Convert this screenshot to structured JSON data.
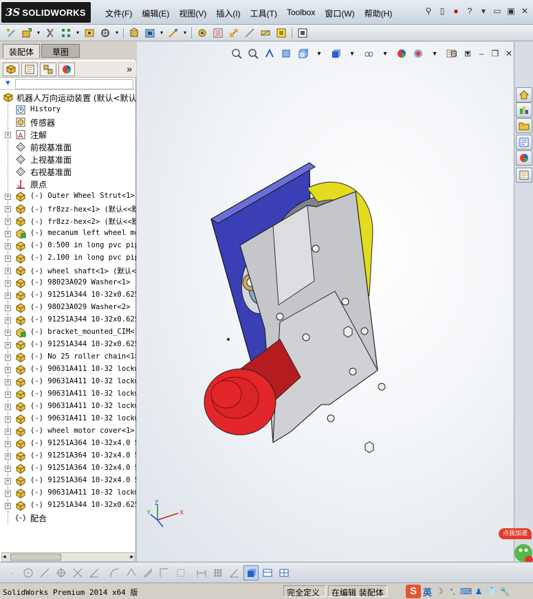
{
  "app": {
    "logo_prefix": "3S",
    "logo_text": "SOLIDWORKS"
  },
  "menu": [
    "文件(F)",
    "编辑(E)",
    "视图(V)",
    "插入(I)",
    "工具(T)",
    "Toolbox",
    "窗口(W)",
    "帮助(H)"
  ],
  "panel": {
    "tabs": [
      "装配体",
      "草图"
    ],
    "filter_placeholder": ""
  },
  "tree": {
    "root": "机器人万向运动装置  (默认<默认",
    "items": [
      {
        "label": "History",
        "icon": "history-icon",
        "expandable": false,
        "mono": true
      },
      {
        "label": "传感器",
        "icon": "sensor-icon",
        "expandable": false,
        "mono": false
      },
      {
        "label": "注解",
        "icon": "annotation-icon",
        "expandable": true,
        "mono": false
      },
      {
        "label": "前视基准面",
        "icon": "plane-icon",
        "expandable": false,
        "mono": false
      },
      {
        "label": "上视基准面",
        "icon": "plane-icon",
        "expandable": false,
        "mono": false
      },
      {
        "label": "右视基准面",
        "icon": "plane-icon",
        "expandable": false,
        "mono": false
      },
      {
        "label": "原点",
        "icon": "origin-icon",
        "expandable": false,
        "mono": false
      },
      {
        "label": "(-) Outer Wheel Strut<1>",
        "icon": "part-icon",
        "expandable": true,
        "mono": true
      },
      {
        "label": "(-) fr8zz-hex<1> (默认<<默",
        "icon": "part-icon",
        "expandable": true,
        "mono": true
      },
      {
        "label": "(-) fr8zz-hex<2> (默认<<默",
        "icon": "part-icon",
        "expandable": true,
        "mono": true
      },
      {
        "label": "(-) mecanum left wheel mod",
        "icon": "subassembly-icon",
        "expandable": true,
        "mono": true
      },
      {
        "label": "(-) 0.500 in long pvc pipe",
        "icon": "part-icon",
        "expandable": true,
        "mono": true
      },
      {
        "label": "(-) 2.100 in long pvc pipe",
        "icon": "part-icon",
        "expandable": true,
        "mono": true
      },
      {
        "label": "(-) wheel shaft<1> (默认<",
        "icon": "part-icon",
        "expandable": true,
        "mono": true
      },
      {
        "label": "(-) 98023A029 Washer<1> (",
        "icon": "part-icon",
        "expandable": true,
        "mono": true
      },
      {
        "label": "(-) 91251A344 10-32x0.625",
        "icon": "part-icon",
        "expandable": true,
        "mono": true
      },
      {
        "label": "(-) 98023A029 Washer<2> (",
        "icon": "part-icon",
        "expandable": true,
        "mono": true
      },
      {
        "label": "(-) 91251A344 10-32x0.625",
        "icon": "part-icon",
        "expandable": true,
        "mono": true
      },
      {
        "label": "(-) bracket_mounted_CIM<1",
        "icon": "subassembly-icon",
        "expandable": true,
        "mono": true
      },
      {
        "label": "(-) 91251A344 10-32x0.625",
        "icon": "part-icon",
        "expandable": true,
        "mono": true
      },
      {
        "label": "(-) No 25 roller chain<1>",
        "icon": "part-icon",
        "expandable": true,
        "mono": true
      },
      {
        "label": "(-) 90631A411 10-32 lockwa",
        "icon": "part-icon",
        "expandable": true,
        "mono": true
      },
      {
        "label": "(-) 90631A411 10-32 lockwa",
        "icon": "part-icon",
        "expandable": true,
        "mono": true
      },
      {
        "label": "(-) 90631A411 10-32 lockwa",
        "icon": "part-icon",
        "expandable": true,
        "mono": true
      },
      {
        "label": "(-) 90631A411 10-32 lockwa",
        "icon": "part-icon",
        "expandable": true,
        "mono": true
      },
      {
        "label": "(-) 90631A411 10-32 lockwa",
        "icon": "part-icon",
        "expandable": true,
        "mono": true
      },
      {
        "label": "(-) wheel motor cover<1>",
        "icon": "part-icon",
        "expandable": true,
        "mono": true
      },
      {
        "label": "(-) 91251A364 10-32x4.0 SH",
        "icon": "part-icon",
        "expandable": true,
        "mono": true
      },
      {
        "label": "(-) 91251A364 10-32x4.0 SH",
        "icon": "part-icon",
        "expandable": true,
        "mono": true
      },
      {
        "label": "(-) 91251A364 10-32x4.0 SH",
        "icon": "part-icon",
        "expandable": true,
        "mono": true
      },
      {
        "label": "(-) 91251A364 10-32x4.0 SH",
        "icon": "part-icon",
        "expandable": true,
        "mono": true
      },
      {
        "label": "(-) 90631A411 10-32 lockwa",
        "icon": "part-icon",
        "expandable": true,
        "mono": true
      },
      {
        "label": "(-) 91251A344 10-32x0.625",
        "icon": "part-icon",
        "expandable": true,
        "mono": true
      },
      {
        "label": "配合",
        "icon": "mates-icon",
        "expandable": false,
        "mono": false
      }
    ]
  },
  "triad": {
    "x": "X",
    "y": "Y",
    "z": "Z"
  },
  "promo": {
    "badge": "点我加速"
  },
  "status": {
    "app": "SolidWorks Premium 2014 x64 版",
    "definition": "完全定义",
    "mode": "在编辑 装配体"
  },
  "ime": {
    "lang": "英"
  },
  "colors": {
    "accent": "#e31b23",
    "motor": "#e3262a",
    "frame": "#c4c6ca",
    "plate": "#3a3fb5",
    "roller": "#9aa1a8",
    "belt": "#e3dc1e"
  }
}
